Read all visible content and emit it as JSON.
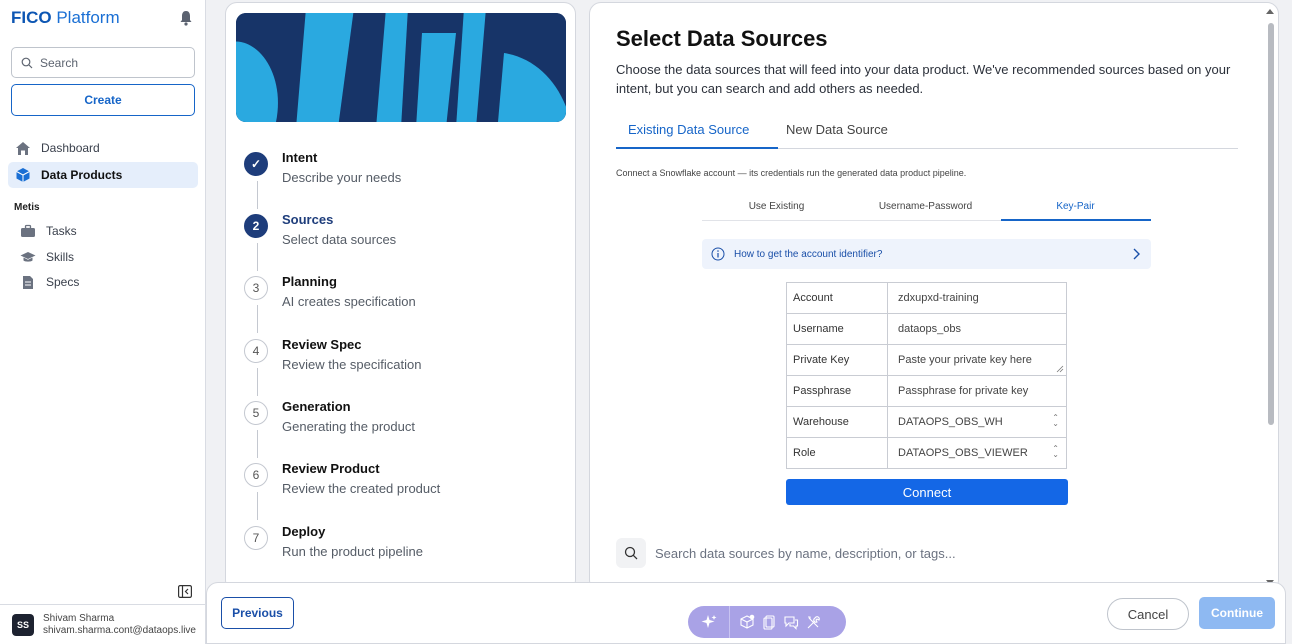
{
  "sidebar": {
    "brand_bold": "FICO",
    "brand_rest": " Platform",
    "search_placeholder": "Search",
    "create_label": "Create",
    "nav": [
      {
        "label": "Dashboard",
        "icon": "home-icon"
      },
      {
        "label": "Data Products",
        "icon": "cube-icon"
      }
    ],
    "section_label": "Metis",
    "sub_items": [
      {
        "label": "Tasks",
        "icon": "briefcase-icon"
      },
      {
        "label": "Skills",
        "icon": "graduation-cap-icon"
      },
      {
        "label": "Specs",
        "icon": "document-icon"
      }
    ],
    "user": {
      "initials": "SS",
      "name": "Shivam Sharma",
      "email": "shivam.sharma.cont@dataops.live"
    }
  },
  "steps": [
    {
      "number": "✓",
      "title": "Intent",
      "desc": "Describe your needs",
      "state": "done"
    },
    {
      "number": "2",
      "title": "Sources",
      "desc": "Select data sources",
      "state": "current"
    },
    {
      "number": "3",
      "title": "Planning",
      "desc": "AI creates specification",
      "state": "pending"
    },
    {
      "number": "4",
      "title": "Review Spec",
      "desc": "Review the specification",
      "state": "pending"
    },
    {
      "number": "5",
      "title": "Generation",
      "desc": "Generating the product",
      "state": "pending"
    },
    {
      "number": "6",
      "title": "Review Product",
      "desc": "Review the created product",
      "state": "pending"
    },
    {
      "number": "7",
      "title": "Deploy",
      "desc": "Run the product pipeline",
      "state": "pending"
    }
  ],
  "main": {
    "title": "Select Data Sources",
    "description": "Choose the data sources that will feed into your data product. We've recommended sources based on your intent, but you can search and add others as needed.",
    "tabs": [
      "Existing Data Source",
      "New Data Source"
    ],
    "hint": "Connect a Snowflake account — its credentials run the generated data product pipeline.",
    "subtabs": [
      "Use Existing",
      "Username-Password",
      "Key-Pair"
    ],
    "info_link": "How to get the account identifier?",
    "form": {
      "account_label": "Account",
      "account_value": "zdxupxd-training",
      "username_label": "Username",
      "username_value": "dataops_obs",
      "private_key_label": "Private Key",
      "private_key_placeholder": "Paste your private key here",
      "passphrase_label": "Passphrase",
      "passphrase_placeholder": "Passphrase for private key",
      "warehouse_label": "Warehouse",
      "warehouse_value": "DATAOPS_OBS_WH",
      "role_label": "Role",
      "role_value": "DATAOPS_OBS_VIEWER"
    },
    "connect_label": "Connect",
    "search_placeholder": "Search data sources by name, description, or tags..."
  },
  "bottom": {
    "previous_label": "Previous",
    "cancel_label": "Cancel",
    "continue_label": "Continue"
  },
  "colors": {
    "accent": "#1665c8",
    "step_active": "#1e3d7b",
    "connect": "#1467e6",
    "toolbar": "#a9a2e6",
    "hero_dark": "#173468",
    "hero_light": "#2aa9e0"
  }
}
